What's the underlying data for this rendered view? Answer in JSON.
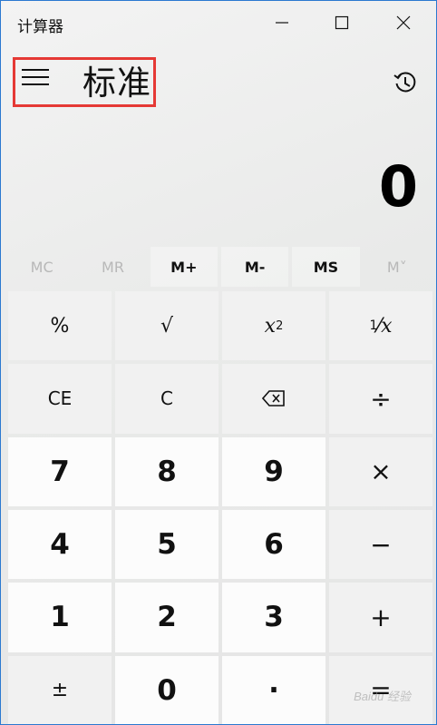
{
  "window": {
    "title": "计算器",
    "accent_color": "#2b79d0",
    "controls": [
      {
        "icon": "minimize-icon"
      },
      {
        "icon": "maximize-icon"
      },
      {
        "icon": "close-icon"
      }
    ]
  },
  "header": {
    "menu_icon": "hamburger-menu-icon",
    "mode": "标准",
    "history_icon": "history-icon",
    "highlight_color": "#e53935"
  },
  "display": {
    "value": "0"
  },
  "memory": {
    "buttons": [
      {
        "label": "MC",
        "enabled": false
      },
      {
        "label": "MR",
        "enabled": false
      },
      {
        "label": "M+",
        "enabled": true
      },
      {
        "label": "M-",
        "enabled": true
      },
      {
        "label": "MS",
        "enabled": true
      },
      {
        "label": "M˅",
        "enabled": false
      }
    ]
  },
  "keypad": {
    "percent": "%",
    "sqrt": "√",
    "square_base": "x",
    "square_exp": "2",
    "reciprocal_num": "1",
    "reciprocal_den": "x",
    "clear_entry": "CE",
    "clear": "C",
    "backspace_icon": "backspace-icon",
    "divide": "÷",
    "multiply": "×",
    "minus": "−",
    "plus": "+",
    "equals": "=",
    "negate": "±",
    "decimal": "·",
    "digits": [
      "0",
      "1",
      "2",
      "3",
      "4",
      "5",
      "6",
      "7",
      "8",
      "9"
    ]
  },
  "watermark": "Baidu 经验"
}
